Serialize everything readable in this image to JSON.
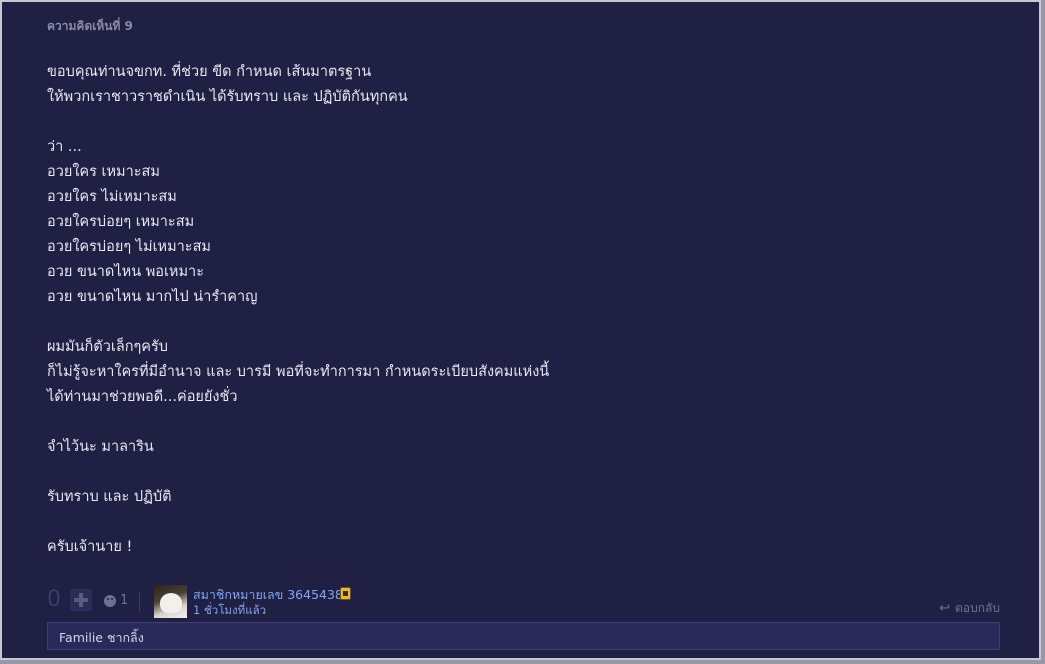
{
  "comment": {
    "number_label": "ความคิดเห็นที่ 9",
    "lines": [
      "ขอบคุณท่านจขกท. ที่ช่วย ขีด กำหนด เส้นมาตรฐาน",
      "ให้พวกเราชาวราชดำเนิน ได้รับทราบ และ ปฏิบัติกันทุกคน",
      "",
      "ว่า ...",
      "อวยใคร เหมาะสม",
      "อวยใคร ไม่เหมาะสม",
      "อวยใครบ่อยๆ เหมาะสม",
      "อวยใครบ่อยๆ ไม่เหมาะสม",
      "อวย ขนาดไหน พอเหมาะ",
      "อวย ขนาดไหน มากไป น่ารำคาญ",
      "",
      "ผมมันก็ตัวเล็กๆครับ",
      "ก็ไม่รู้จะหาใครที่มีอำนาจ และ บารมี พอที่จะทำการมา กำหนดระเบียบสังคมแห่งนี้",
      "ได้ท่านมาช่วยพอดี...ค่อยยังชั่ว",
      "",
      "จำไว้นะ มาลาริน",
      "",
      "รับทราบ และ ปฏิบัติ",
      "",
      "ครับเจ้านาย !"
    ]
  },
  "footer": {
    "vote_count": "0",
    "emoji_count": "1",
    "member_name": "สมาชิกหมายเลข 3645438",
    "timestamp": "1 ชั่วโมงที่แล้ว",
    "reply_label": "ตอบกลับ"
  },
  "reply_bar": {
    "text": "Familie ชากลิ้ง"
  },
  "icons": {
    "plus": "plus-icon",
    "emoji": "emoji-icon",
    "badge": "member-badge-icon",
    "reply": "reply-arrow-icon"
  },
  "colors": {
    "background": "#202045",
    "text": "#e8e8f0",
    "link": "#7fa6f0",
    "muted": "#6f6f8e"
  }
}
